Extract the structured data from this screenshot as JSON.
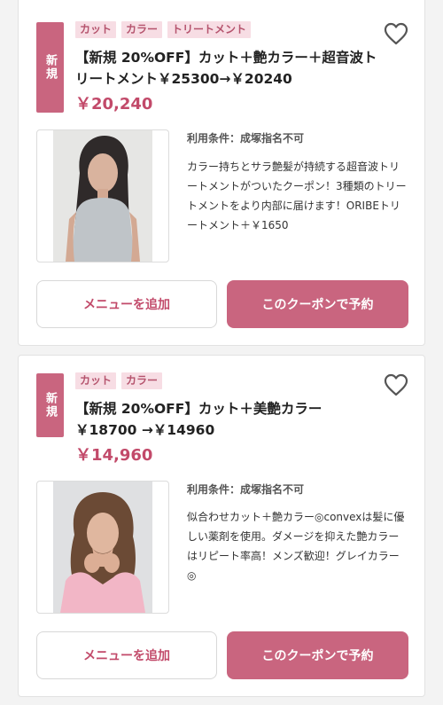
{
  "coupons": [
    {
      "badge": "新規",
      "tags": [
        "カット",
        "カラー",
        "トリートメント"
      ],
      "title": "【新規 20%OFF】カット＋艶カラー＋超音波トリートメント￥25300→￥20240",
      "price": "￥20,240",
      "conditions": "利用条件：成塚指名不可",
      "description": "カラー持ちとサラ艶髪が持続する超音波トリートメントがついたクーポン！3種類のトリートメントをより内部に届けます！ORIBEトリートメント＋￥1650",
      "add_menu_label": "メニューを追加",
      "reserve_label": "このクーポンで予約"
    },
    {
      "badge": "新規",
      "tags": [
        "カット",
        "カラー"
      ],
      "title": "【新規 20%OFF】カット＋美艶カラー ￥18700 →￥14960",
      "price": "￥14,960",
      "conditions": "利用条件：成塚指名不可",
      "description": "似合わせカット＋艶カラー◎convexは髪に優しい薬剤を使用。ダメージを抑えた艶カラーはリピート率高！メンズ歓迎！グレイカラー◎",
      "add_menu_label": "メニューを追加",
      "reserve_label": "このクーポンで予約"
    }
  ],
  "colors": {
    "accent": "#c9657f",
    "price": "#c24a6a",
    "tag_bg": "#f7dde4"
  },
  "icons": {
    "favorite": "heart-outline-icon"
  }
}
